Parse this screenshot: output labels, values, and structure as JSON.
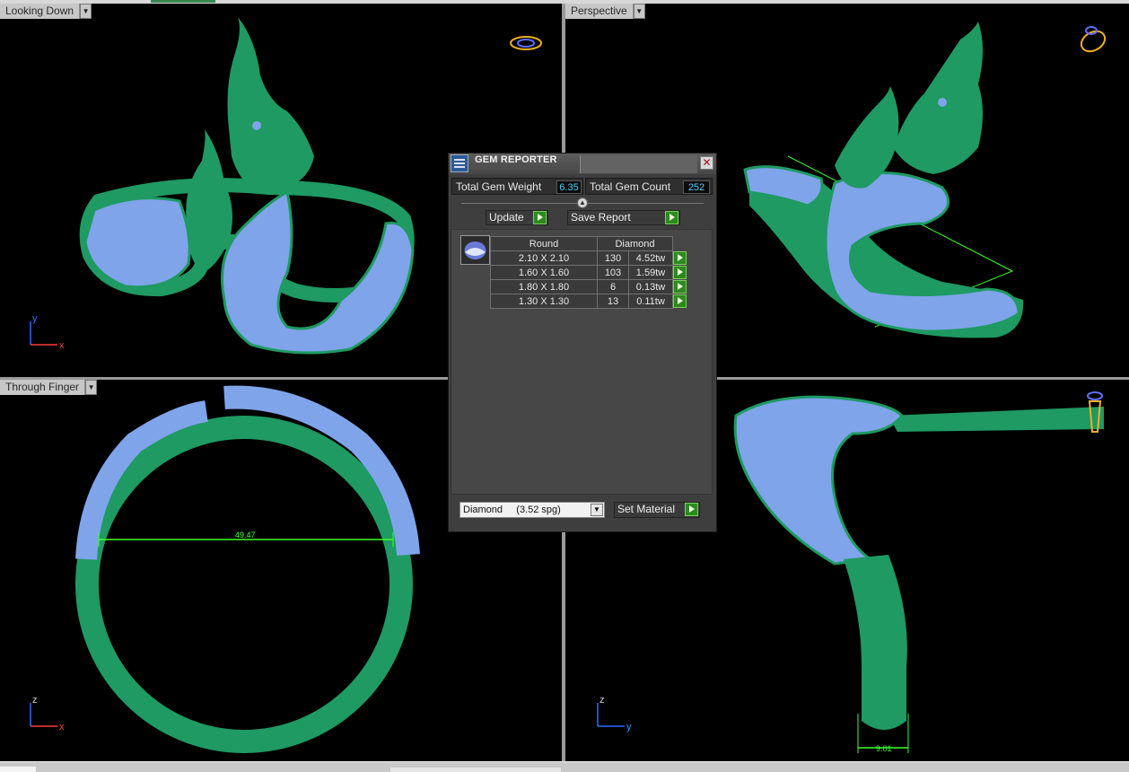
{
  "viewports": {
    "top_left": {
      "label": "Looking Down",
      "axis_a": "y",
      "axis_b": "x"
    },
    "top_right": {
      "label": "Perspective"
    },
    "bottom_left": {
      "label": "Through Finger",
      "axis_a": "z",
      "axis_b": "x",
      "dimension": "49.47"
    },
    "bottom_right": {
      "axis_a": "z",
      "axis_b": "y",
      "dimension": "9.01"
    }
  },
  "gem_reporter": {
    "title": "GEM REPORTER",
    "close_symbol": "✕",
    "total_gem_weight_label": "Total Gem Weight",
    "total_gem_weight_value": "6.35",
    "total_gem_count_label": "Total Gem Count",
    "total_gem_count_value": "252",
    "update_label": "Update",
    "save_report_label": "Save Report",
    "table": {
      "headers": [
        "Round",
        "Diamond"
      ],
      "rows": [
        {
          "size": "2.10 X 2.10",
          "count": "130",
          "weight": "4.52tw"
        },
        {
          "size": "1.60 X 1.60",
          "count": "103",
          "weight": "1.59tw"
        },
        {
          "size": "1.80 X 1.80",
          "count": "6",
          "weight": "0.13tw"
        },
        {
          "size": "1.30 X 1.30",
          "count": "13",
          "weight": "0.11tw"
        }
      ]
    },
    "material_select_value": "Diamond     (3.52 spg)",
    "set_material_label": "Set Material"
  },
  "colors": {
    "metal": "#1e9a62",
    "gems": "#7fa4ea",
    "dimension_line": "#3dff2a",
    "background": "#000000"
  },
  "icons": [
    "ring-orientation-icon",
    "gem-reporter-icon",
    "play-arrow-icon",
    "dropdown-arrow-icon",
    "close-icon"
  ]
}
